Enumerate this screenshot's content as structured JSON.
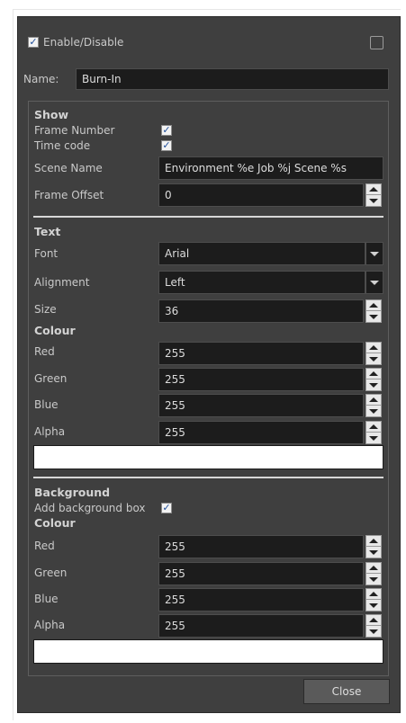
{
  "header": {
    "enable_label": "Enable/Disable",
    "enable_checked": true,
    "right_checked": false,
    "name_label": "Name:",
    "name_value": "Burn-In"
  },
  "show": {
    "heading": "Show",
    "frame_number_label": "Frame Number",
    "frame_number_checked": true,
    "time_code_label": "Time code",
    "time_code_checked": true,
    "scene_name_label": "Scene Name",
    "scene_name_value": "Environment %e Job %j Scene %s",
    "frame_offset_label": "Frame Offset",
    "frame_offset_value": "0"
  },
  "text": {
    "heading": "Text",
    "font_label": "Font",
    "font_value": "Arial",
    "alignment_label": "Alignment",
    "alignment_value": "Left",
    "size_label": "Size",
    "size_value": "36",
    "colour_heading": "Colour",
    "red_label": "Red",
    "red_value": "255",
    "green_label": "Green",
    "green_value": "255",
    "blue_label": "Blue",
    "blue_value": "255",
    "alpha_label": "Alpha",
    "alpha_value": "255",
    "swatch_color": "#ffffff"
  },
  "background": {
    "heading": "Background",
    "add_box_label": "Add background box",
    "add_box_checked": true,
    "colour_heading": "Colour",
    "red_label": "Red",
    "red_value": "255",
    "green_label": "Green",
    "green_value": "255",
    "blue_label": "Blue",
    "blue_value": "255",
    "alpha_label": "Alpha",
    "alpha_value": "255",
    "swatch_color": "#ffffff"
  },
  "footer": {
    "close_label": "Close"
  },
  "icons": {
    "checkmark": "✓",
    "spin_up": "up-arrow-icon",
    "spin_down": "down-arrow-icon",
    "dropdown": "chevron-down-icon"
  }
}
